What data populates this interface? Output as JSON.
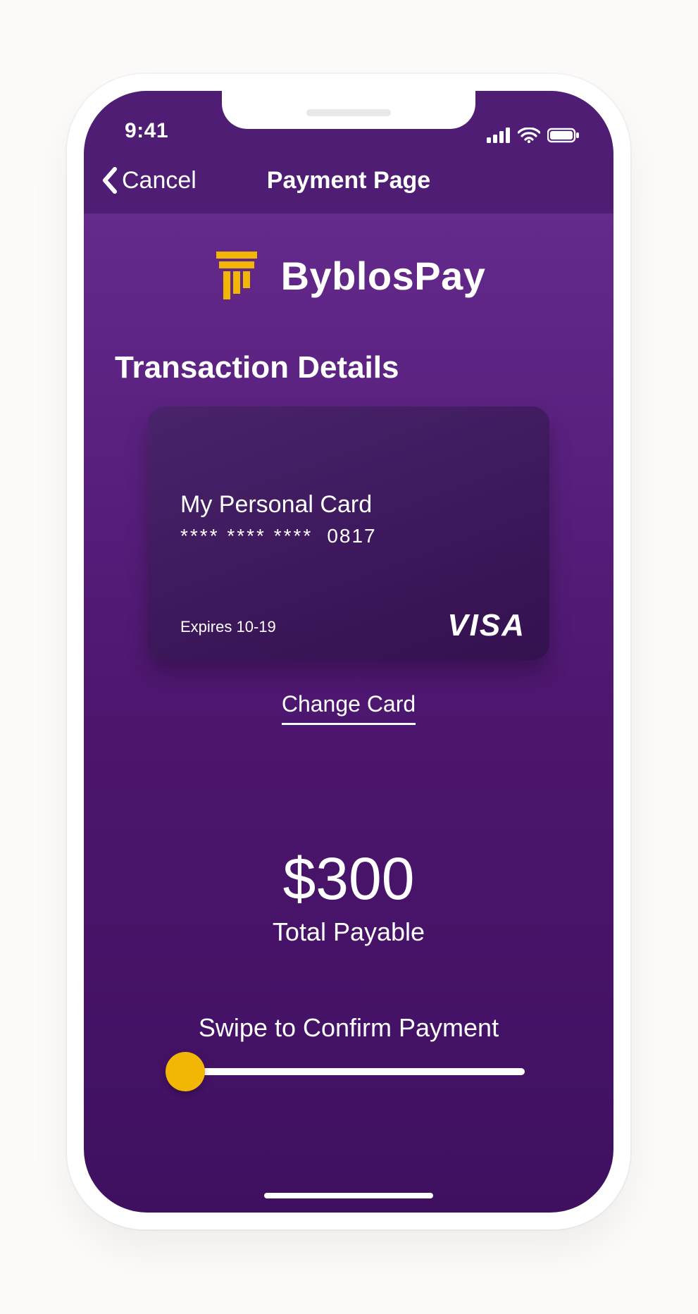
{
  "status": {
    "time": "9:41"
  },
  "nav": {
    "back_label": "Cancel",
    "title": "Payment Page"
  },
  "brand": {
    "name": "ByblosPay",
    "accent": "#f2b705"
  },
  "section": {
    "title": "Transaction Details"
  },
  "card": {
    "name": "My Personal Card",
    "masked": "****  ****  ****",
    "last4": "0817",
    "expiry": "Expires 10-19",
    "network": "VISA"
  },
  "actions": {
    "change_card": "Change Card"
  },
  "payment": {
    "amount": "$300",
    "amount_label": "Total Payable",
    "swipe_label": "Swipe to Confirm Payment"
  },
  "colors": {
    "bg_top": "#4f1d74",
    "bg_mid": "#5d2886",
    "bg_low": "#3f1060",
    "accent": "#f2b705"
  }
}
